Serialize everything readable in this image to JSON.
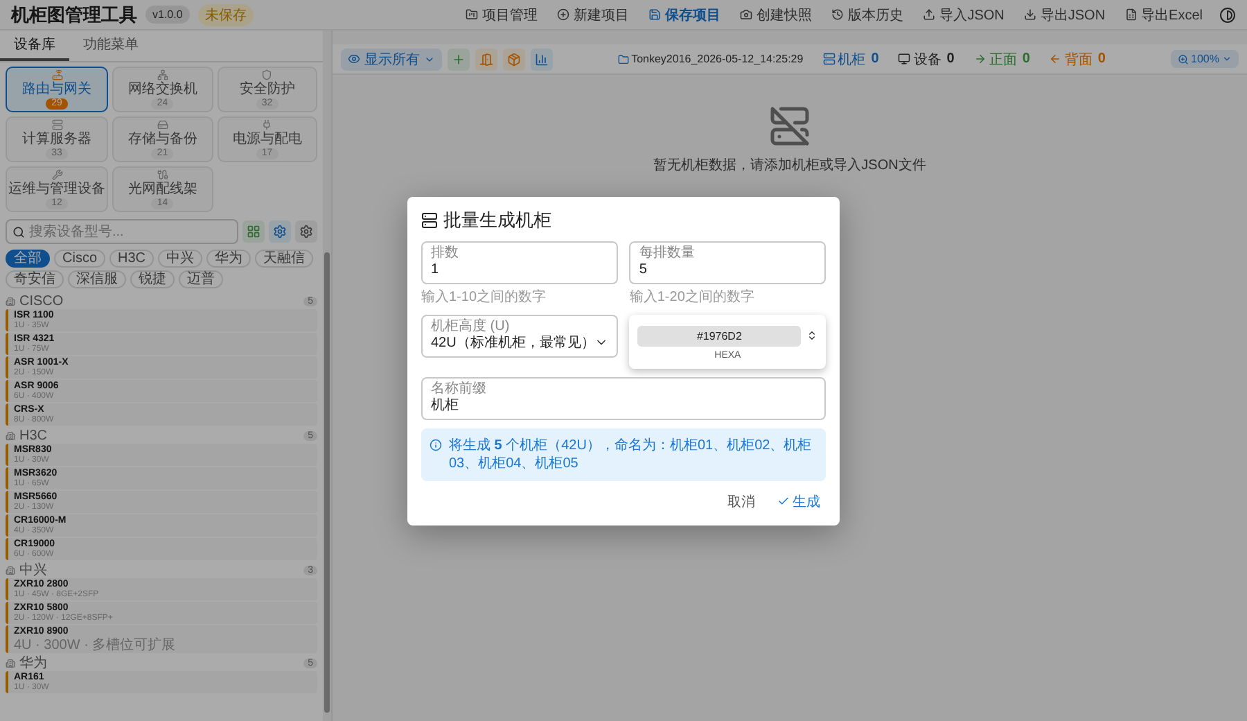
{
  "app": {
    "title": "机柜图管理工具",
    "version": "v1.0.0",
    "save_state": "未保存"
  },
  "top_menu": [
    {
      "label": "项目管理",
      "selected": false
    },
    {
      "label": "新建项目",
      "selected": false
    },
    {
      "label": "保存项目",
      "selected": true
    },
    {
      "label": "创建快照",
      "selected": false
    },
    {
      "label": "版本历史",
      "selected": false
    },
    {
      "label": "导入JSON",
      "selected": false
    },
    {
      "label": "导出JSON",
      "selected": false
    },
    {
      "label": "导出Excel",
      "selected": false
    }
  ],
  "sidebar": {
    "tabs": [
      {
        "label": "设备库",
        "selected": true
      },
      {
        "label": "功能菜单",
        "selected": false
      }
    ],
    "categories": [
      {
        "label": "路由与网关",
        "count": "29",
        "selected": true
      },
      {
        "label": "网络交换机",
        "count": "24",
        "selected": false
      },
      {
        "label": "安全防护",
        "count": "32",
        "selected": false
      },
      {
        "label": "计算服务器",
        "count": "33",
        "selected": false
      },
      {
        "label": "存储与备份",
        "count": "21",
        "selected": false
      },
      {
        "label": "电源与配电",
        "count": "17",
        "selected": false
      },
      {
        "label": "运维与管理设备",
        "count": "12",
        "selected": false
      },
      {
        "label": "光网配线架",
        "count": "14",
        "selected": false
      }
    ],
    "search": {
      "placeholder": "搜索设备型号..."
    },
    "brands": [
      {
        "label": "全部",
        "selected": true
      },
      {
        "label": "Cisco",
        "selected": false
      },
      {
        "label": "H3C",
        "selected": false
      },
      {
        "label": "中兴",
        "selected": false
      },
      {
        "label": "华为",
        "selected": false
      },
      {
        "label": "天融信",
        "selected": false
      },
      {
        "label": "奇安信",
        "selected": false
      },
      {
        "label": "深信服",
        "selected": false
      },
      {
        "label": "锐捷",
        "selected": false
      },
      {
        "label": "迈普",
        "selected": false
      }
    ],
    "groups": [
      {
        "name": "CISCO",
        "count": "5",
        "items": [
          {
            "name": "ISR 1100",
            "spec": "1U · 35W"
          },
          {
            "name": "ISR 4321",
            "spec": "1U · 75W"
          },
          {
            "name": "ASR 1001-X",
            "spec": "2U · 150W"
          },
          {
            "name": "ASR 9006",
            "spec": "6U · 400W"
          },
          {
            "name": "CRS-X",
            "spec": "8U · 800W"
          }
        ]
      },
      {
        "name": "H3C",
        "count": "5",
        "items": [
          {
            "name": "MSR830",
            "spec": "1U · 30W"
          },
          {
            "name": "MSR3620",
            "spec": "1U · 65W"
          },
          {
            "name": "MSR5660",
            "spec": "2U · 130W"
          },
          {
            "name": "CR16000-M",
            "spec": "4U · 350W"
          },
          {
            "name": "CR19000",
            "spec": "6U · 600W"
          }
        ]
      },
      {
        "name": "中兴",
        "count": "3",
        "items": [
          {
            "name": "ZXR10 2800",
            "spec": "1U · 45W · 8GE+2SFP"
          },
          {
            "name": "ZXR10 5800",
            "spec": "2U · 120W · 12GE+8SFP+"
          },
          {
            "name": "ZXR10 8900",
            "spec": "4U · 300W · 多槽位可扩展"
          }
        ]
      },
      {
        "name": "华为",
        "count": "5",
        "items": [
          {
            "name": "AR161",
            "spec": "1U · 30W"
          }
        ]
      }
    ]
  },
  "toolbar": {
    "filter": "显示所有",
    "project": "Tonkey2016_2026-05-12_14:25:29",
    "stats": [
      {
        "label": "机柜",
        "value": "0",
        "kind": "racks"
      },
      {
        "label": "设备",
        "value": "0",
        "kind": "devices"
      },
      {
        "label": "正面",
        "value": "0",
        "kind": "front"
      },
      {
        "label": "背面",
        "value": "0",
        "kind": "back"
      }
    ],
    "zoom": "100%"
  },
  "empty_state": {
    "message": "暂无机柜数据，请添加机柜或导入JSON文件"
  },
  "dialog": {
    "title": "批量生成机柜",
    "fields": [
      {
        "kind": "number",
        "label": "排数",
        "value": "1",
        "hint": "输入1-10之间的数字"
      },
      {
        "kind": "number",
        "label": "每排数量",
        "value": "5",
        "hint": "输入1-20之间的数字"
      },
      {
        "kind": "select",
        "label": "机柜高度 (U)",
        "value": "42U（标准机柜，最常见）"
      },
      {
        "kind": "color",
        "value": "#1976D2",
        "mode": "HEXA"
      },
      {
        "kind": "text",
        "label": "名称前缀",
        "value": "机柜"
      }
    ],
    "info": "将生成 **5** 个机柜（42U），命名为：机柜01、机柜02、机柜03、机柜04、机柜05",
    "buttons": [
      {
        "label": "取消",
        "kind": "text"
      },
      {
        "label": "生成",
        "kind": "primary"
      }
    ]
  }
}
